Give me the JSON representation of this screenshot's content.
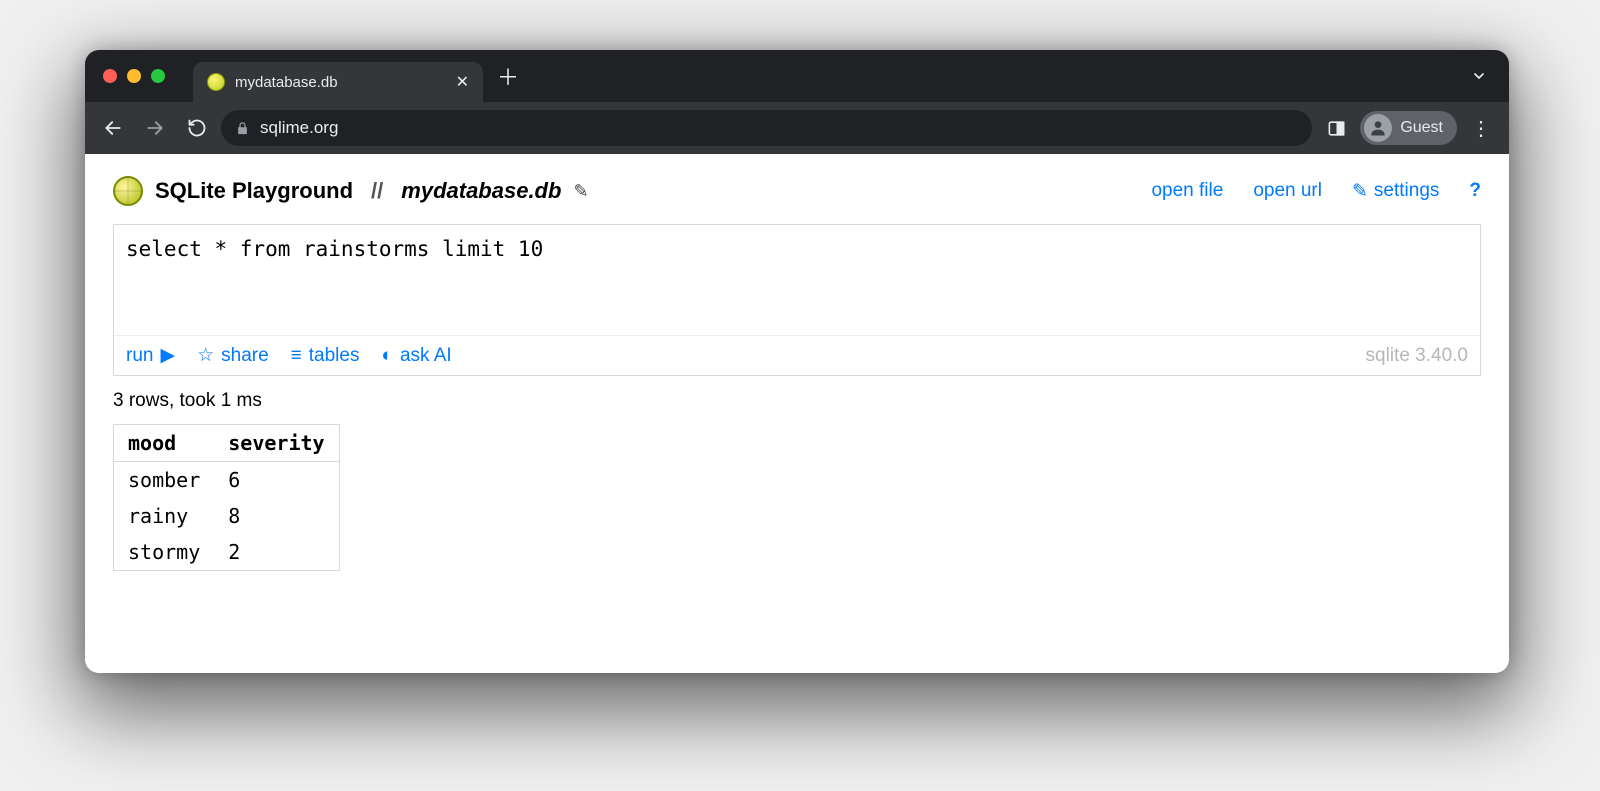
{
  "chrome": {
    "tab_title": "mydatabase.db",
    "url": "sqlime.org",
    "profile_label": "Guest"
  },
  "header": {
    "app_title": "SQLite Playground",
    "separator": "//",
    "db_name": "mydatabase.db",
    "links": {
      "open_file": "open file",
      "open_url": "open url",
      "settings_icon": "✎",
      "settings": "settings",
      "help": "?"
    }
  },
  "editor": {
    "query": "select * from rainstorms limit 10",
    "toolbar": {
      "run": "run",
      "run_glyph": "▶",
      "share": "share",
      "share_glyph": "☆",
      "tables": "tables",
      "tables_glyph": "≡",
      "ask_ai": "ask AI",
      "ask_ai_glyph": "◐"
    },
    "version": "sqlite 3.40.0"
  },
  "result": {
    "status": "3 rows, took 1 ms",
    "columns": [
      "mood",
      "severity"
    ],
    "rows": [
      {
        "mood": "somber",
        "severity": "6"
      },
      {
        "mood": "rainy",
        "severity": "8"
      },
      {
        "mood": "stormy",
        "severity": "2"
      }
    ]
  }
}
